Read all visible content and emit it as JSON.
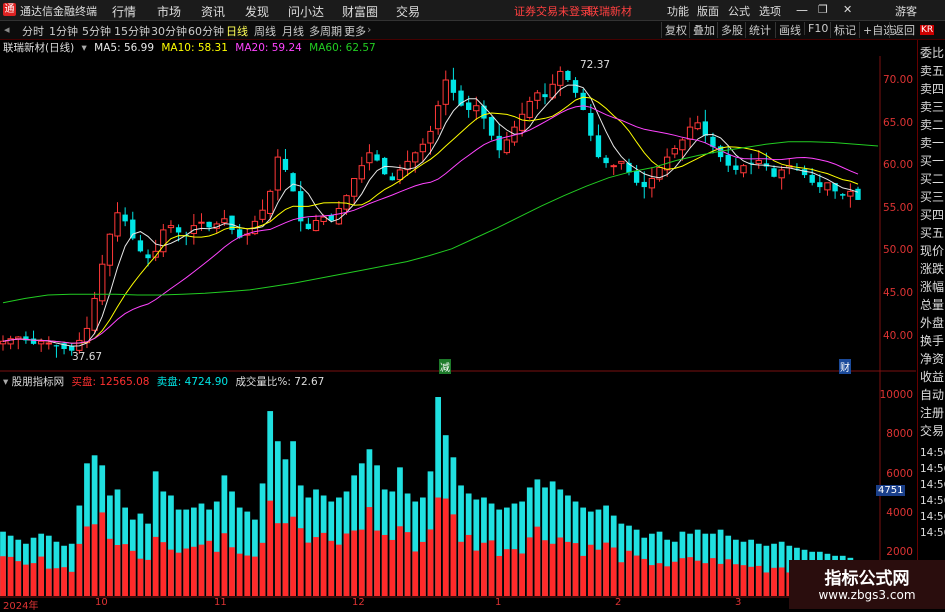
{
  "app": {
    "title": "通达信金融终端",
    "menus": [
      "行情",
      "市场",
      "资讯",
      "发现",
      "问小达",
      "财富圈",
      "交易"
    ],
    "status_text": "证券交易未登录",
    "stock_name_top": "联瑞新材",
    "right_menus": [
      "功能",
      "版面",
      "公式",
      "选项"
    ],
    "window_controls": [
      "minimize-icon",
      "restore-icon",
      "close-icon"
    ],
    "guest": "游客"
  },
  "toolbar": {
    "periods": [
      "分时",
      "1分钟",
      "5分钟",
      "15分钟",
      "30分钟",
      "60分钟",
      "日线",
      "周线",
      "月线",
      "多周期",
      "更多"
    ],
    "active_period": "日线",
    "right_buttons": [
      "复权",
      "叠加",
      "多股",
      "统计",
      "画线",
      "F10",
      "标记",
      "+自选",
      "返回"
    ]
  },
  "chart_header": {
    "title": "联瑞新材(日线)",
    "ma5": "MA5: 56.99",
    "ma10": "MA10: 58.31",
    "ma20": "MA20: 59.24",
    "ma60": "MA60: 62.57",
    "colors": {
      "ma5": "#e8e8e8",
      "ma10": "#ffff00",
      "ma20": "#ff44ff",
      "ma60": "#22cc22"
    }
  },
  "price_axis": [
    "70.00",
    "65.00",
    "60.00",
    "55.00",
    "50.00",
    "45.00",
    "40.00"
  ],
  "annotations": {
    "high": "72.37",
    "low": "37.67",
    "tag_reduce": "减",
    "tag_fin": "财"
  },
  "indicator_header": {
    "name": "股朋指标网",
    "buy": "买盘: 12565.08",
    "sell": "卖盘: 4724.90",
    "ratio": "成交量比%: 72.67"
  },
  "volume_axis": [
    "10000",
    "8000",
    "6000",
    "4000",
    "2000"
  ],
  "volume_marker": "4751",
  "x_axis": [
    "2024年",
    "10",
    "11",
    "12",
    "1",
    "2",
    "3"
  ],
  "sidebar": {
    "badge": "KR",
    "items": [
      "委比",
      "卖五",
      "卖四",
      "卖三",
      "卖二",
      "卖一",
      "买一",
      "买二",
      "买三",
      "买四",
      "买五",
      "现价",
      "涨跌",
      "涨幅",
      "总量",
      "外盘",
      "换手",
      "净资",
      "收益",
      "自动",
      "注册",
      "交易"
    ],
    "times": [
      "14:56",
      "14:56",
      "14:56",
      "14:56",
      "14:56",
      "14:56"
    ]
  },
  "watermark": {
    "title": "指标公式网",
    "url": "www.zbgs3.com"
  },
  "chart_data": {
    "type": "candlestick",
    "title": "联瑞新材(日线)",
    "ylim": [
      37,
      73
    ],
    "closes": [
      39.5,
      39.8,
      40.0,
      39.6,
      39.2,
      39.5,
      39.3,
      38.9,
      38.6,
      38.4,
      39.6,
      41.0,
      44.5,
      48.5,
      52.0,
      54.5,
      53.5,
      51.5,
      50.0,
      49.2,
      50.0,
      52.5,
      53.0,
      52.2,
      51.8,
      53.0,
      53.4,
      52.8,
      53.2,
      53.8,
      52.5,
      51.6,
      52.0,
      53.5,
      54.8,
      57.0,
      61.0,
      59.5,
      57.0,
      53.5,
      52.6,
      53.6,
      54.0,
      53.6,
      55.0,
      56.5,
      58.5,
      60.0,
      61.5,
      60.6,
      59.0,
      58.3,
      59.5,
      60.5,
      61.5,
      62.5,
      64.0,
      67.0,
      70.0,
      68.5,
      67.0,
      66.5,
      67.0,
      65.5,
      63.5,
      61.8,
      63.0,
      64.5,
      66.0,
      67.5,
      68.5,
      68.0,
      69.5,
      71.0,
      70.0,
      68.5,
      66.5,
      63.5,
      61.0,
      60.3,
      60.0,
      60.5,
      59.2,
      58.0,
      57.5,
      58.5,
      59.8,
      61.0,
      62.0,
      63.0,
      64.5,
      65.0,
      63.5,
      62.2,
      61.0,
      60.0,
      59.5,
      60.0,
      60.3,
      60.6,
      59.9,
      58.7,
      59.5,
      60.0,
      59.6,
      58.9,
      58.0,
      57.5,
      58.0,
      57.0,
      56.5,
      57.0,
      56.0
    ],
    "ma60": [
      44.0,
      44.5,
      44.9,
      45.0,
      45.0,
      45.0,
      44.9,
      44.9,
      45.0,
      45.1,
      45.3,
      45.5,
      45.9,
      46.3,
      46.8,
      47.3,
      47.8,
      48.3,
      48.8,
      49.5,
      50.3,
      51.5,
      52.7,
      54.0,
      55.3,
      56.5,
      57.6,
      58.6,
      59.3,
      59.8,
      60.6,
      61.2,
      61.7,
      62.1,
      62.5,
      62.8,
      62.8,
      62.7,
      62.5,
      62.3
    ],
    "volumes": [
      3200,
      3000,
      2800,
      2600,
      2900,
      3100,
      3000,
      2700,
      2500,
      2600,
      4500,
      6600,
      7000,
      6500,
      5000,
      5300,
      4400,
      3800,
      4100,
      3600,
      6200,
      5200,
      5000,
      4300,
      4300,
      4400,
      4600,
      4300,
      4700,
      6000,
      5200,
      4400,
      4200,
      3800,
      5600,
      9200,
      7700,
      6800,
      7700,
      5500,
      4900,
      5300,
      5000,
      4700,
      4900,
      5200,
      6000,
      6600,
      7300,
      6500,
      5300,
      5200,
      6400,
      5100,
      4700,
      4900,
      6200,
      9900,
      8000,
      6900,
      5500,
      5100,
      4800,
      4900,
      4600,
      4300,
      4400,
      4600,
      4700,
      5400,
      5800,
      5400,
      5700,
      5300,
      5000,
      4700,
      4400,
      4200,
      4300,
      4500,
      4000,
      3600,
      3500,
      3300,
      2900,
      3100,
      3200,
      2800,
      2700,
      3200,
      3100,
      3300,
      3100,
      3100,
      3300,
      3000,
      2800,
      2700,
      2800,
      2600,
      2500,
      2600,
      2700,
      2500,
      2400,
      2300,
      2200,
      2200,
      2100,
      2000,
      2000,
      1900
    ],
    "buy_ratio": 0.55,
    "volume_ylim": [
      0,
      11000
    ],
    "volume_axis_label": "",
    "xlabel": "",
    "ylabel": ""
  }
}
